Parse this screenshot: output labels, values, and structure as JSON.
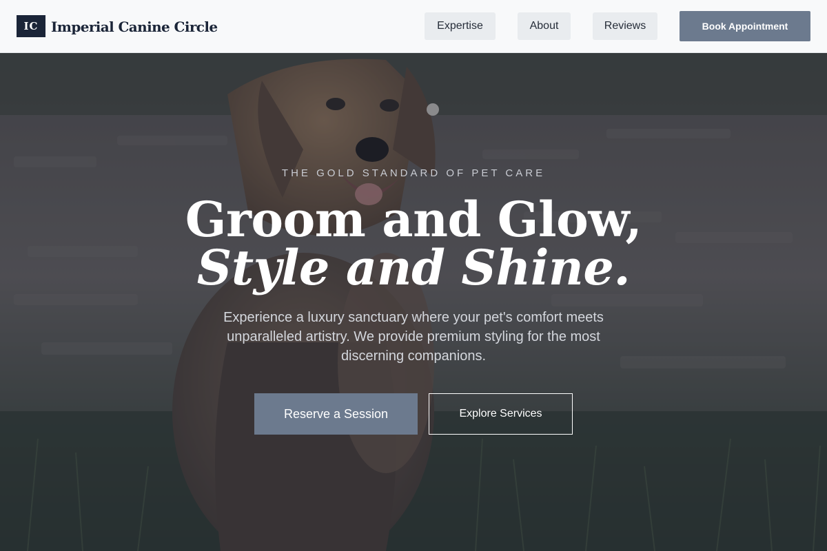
{
  "header": {
    "logo_mark": "IC",
    "brand_name": "Imperial Canine Circle",
    "nav": [
      {
        "label": "Expertise"
      },
      {
        "label": "About"
      },
      {
        "label": "Reviews"
      }
    ],
    "book_label": "Book Appointment"
  },
  "hero": {
    "background_image": "dog-sitting-on-grass-photo",
    "eyebrow": "THE GOLD STANDARD OF PET CARE",
    "headline_line1": "Groom and Glow,",
    "headline_line2": "Style and Shine.",
    "lede": "Experience a luxury sanctuary where your pet's comfort meets unparalleled artistry. We provide premium styling for the most discerning companions.",
    "primary_cta": "Reserve a Session",
    "secondary_cta": "Explore Services"
  },
  "colors": {
    "brand_navy": "#1b2538",
    "accent_slate": "#6c7a8e",
    "header_bg": "#f8f9fa",
    "nav_button_bg": "#e9ecef"
  }
}
